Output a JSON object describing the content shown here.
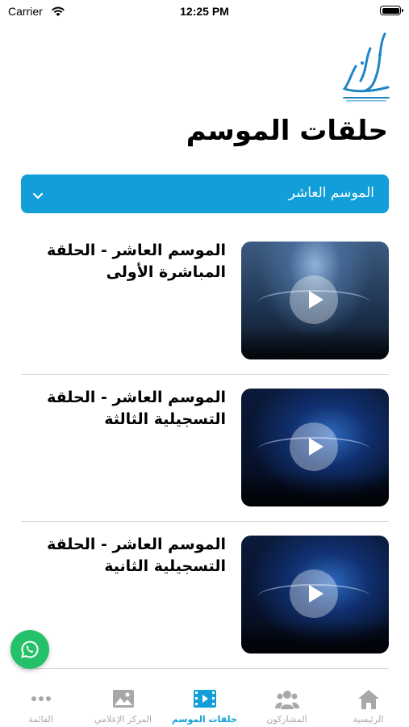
{
  "status_bar": {
    "carrier": "Carrier",
    "time": "12:25 PM"
  },
  "header": {
    "logo_name": "prince-of-poets-logo",
    "page_title": "حلقات الموسم"
  },
  "season_selector": {
    "selected": "الموسم العاشر"
  },
  "episodes": [
    {
      "title": "الموسم العاشر - الحلقة المباشرة الأولى"
    },
    {
      "title": "الموسم العاشر - الحلقة التسجيلية الثالثة"
    },
    {
      "title": "الموسم العاشر - الحلقة التسجيلية الثانية"
    }
  ],
  "tabs": [
    {
      "label": "الرئيسية",
      "icon": "home-icon"
    },
    {
      "label": "المشاركون",
      "icon": "participants-icon"
    },
    {
      "label": "حلقات الموسم",
      "icon": "video-icon",
      "active": true
    },
    {
      "label": "المركز الإعلامي",
      "icon": "image-icon"
    },
    {
      "label": "القائمة",
      "icon": "more-icon"
    }
  ],
  "colors": {
    "accent": "#119ed9",
    "whatsapp": "#25c16a",
    "inactive_tab": "#a8a8a8"
  }
}
